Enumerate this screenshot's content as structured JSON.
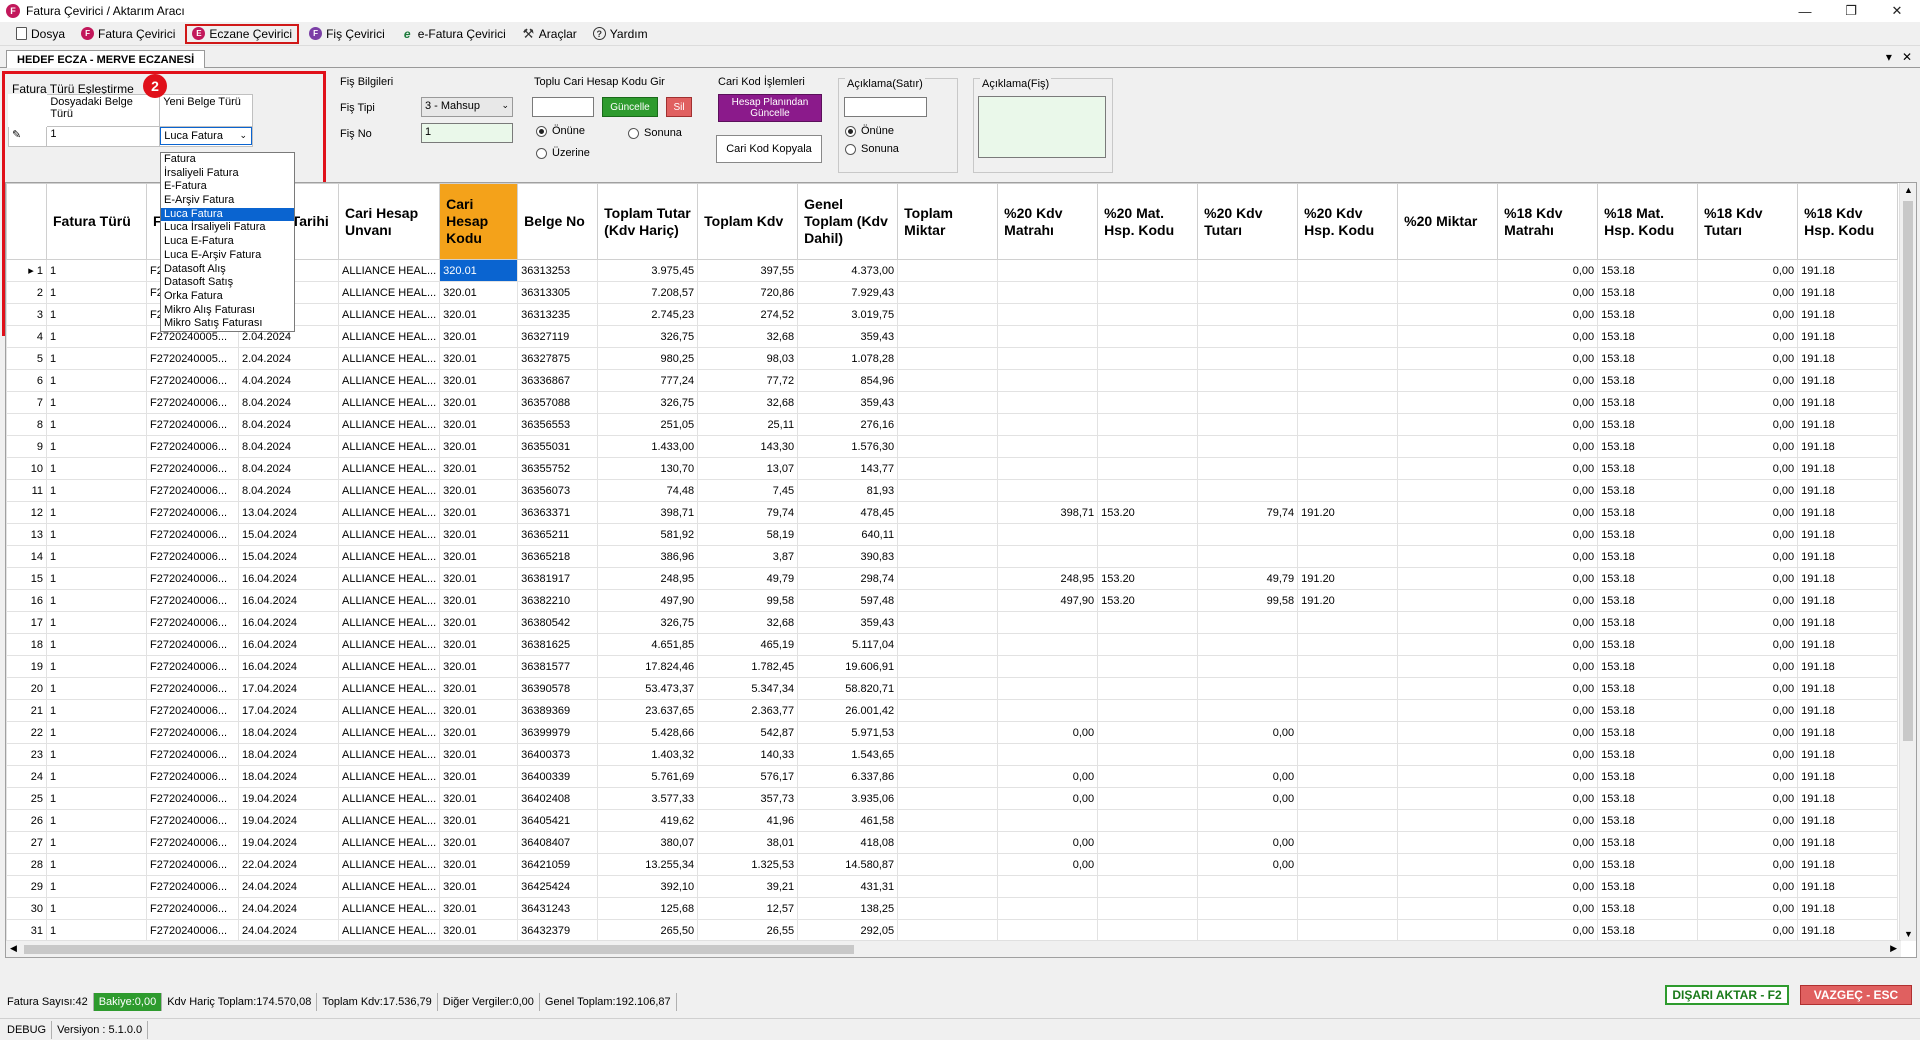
{
  "window": {
    "title": "Fatura Çevirici / Aktarım Aracı",
    "app_icon_letter": "F"
  },
  "menu": [
    {
      "icon": "doc",
      "label": "Dosya"
    },
    {
      "icon": "F",
      "label": "Fatura Çevirici"
    },
    {
      "icon": "E",
      "label": "Eczane Çevirici",
      "selected": true
    },
    {
      "icon": "F",
      "label": "Fiş Çevirici"
    },
    {
      "icon": "e",
      "label": "e-Fatura Çevirici"
    },
    {
      "icon": "tools",
      "label": "Araçlar"
    },
    {
      "icon": "help",
      "label": "Yardım"
    }
  ],
  "tab": {
    "label": "HEDEF ECZA - MERVE ECZANESİ"
  },
  "mapping": {
    "title": "Fatura Türü Eşleştirme",
    "col1": "Dosyadaki Belge Türü",
    "col2": "Yeni Belge Türü",
    "row_value": "1",
    "row_selected": "Luca Fatura",
    "badge": "2",
    "options": [
      "Fatura",
      "İrsaliyeli Fatura",
      "E-Fatura",
      "E-Arşiv Fatura",
      "Luca Fatura",
      "Luca İrsaliyeli Fatura",
      "Luca E-Fatura",
      "Luca E-Arşiv Fatura",
      "Datasoft Alış",
      "Datasoft Satış",
      "Orka Fatura",
      "Mikro Alış Faturası",
      "Mikro Satış Faturası"
    ]
  },
  "fis": {
    "title": "Fiş Bilgileri",
    "tip_label": "Fiş Tipi",
    "tip_value": "3 - Mahsup",
    "no_label": "Fiş No",
    "no_value": "1"
  },
  "toplu": {
    "title": "Toplu Cari Hesap Kodu Gir",
    "update": "Güncelle",
    "delete": "Sil",
    "opt1": "Önüne",
    "opt2": "Sonuna",
    "opt3": "Üzerine"
  },
  "cari": {
    "title": "Cari Kod İşlemleri",
    "btn1": "Hesap Planından Güncelle",
    "btn2": "Cari Kod Kopyala"
  },
  "aciklama_satir": {
    "title": "Açıklama(Satır)",
    "opt1": "Önüne",
    "opt2": "Sonuna"
  },
  "aciklama_fis": {
    "title": "Açıklama(Fiş)"
  },
  "colors": {
    "accent_orange": "#f4a21a",
    "selection_blue": "#0a64d0",
    "red_highlight": "#e0101a",
    "green": "#2e9b2e",
    "purple": "#8b1a8b"
  },
  "grid": {
    "columns": [
      "Fatura Türü",
      "Fatura No",
      "Fatura Tarihi",
      "Cari Hesap Unvanı",
      "Cari Hesap Kodu",
      "Belge No",
      "Toplam Tutar (Kdv Hariç)",
      "Toplam Kdv",
      "Genel Toplam (Kdv Dahil)",
      "Toplam Miktar",
      "%20 Kdv Matrahı",
      "%20 Mat. Hsp. Kodu",
      "%20 Kdv Tutarı",
      "%20 Kdv Hsp. Kodu",
      "%20 Miktar",
      "%18 Kdv Matrahı",
      "%18 Mat. Hsp. Kodu",
      "%18 Kdv Tutarı",
      "%18 Kdv Hsp. Kodu"
    ],
    "rows": [
      [
        "1",
        "1",
        "F2720240005...",
        "",
        "ALLIANCE HEAL...",
        "320.01",
        "36313253",
        "3.975,45",
        "397,55",
        "4.373,00",
        "",
        "",
        "",
        "",
        "",
        "",
        "0,00",
        "153.18",
        "0,00",
        "191.18"
      ],
      [
        "2",
        "1",
        "F2720240005...",
        "",
        "ALLIANCE HEAL...",
        "320.01",
        "36313305",
        "7.208,57",
        "720,86",
        "7.929,43",
        "",
        "",
        "",
        "",
        "",
        "",
        "0,00",
        "153.18",
        "0,00",
        "191.18"
      ],
      [
        "3",
        "1",
        "F2720240005...",
        "",
        "ALLIANCE HEAL...",
        "320.01",
        "36313235",
        "2.745,23",
        "274,52",
        "3.019,75",
        "",
        "",
        "",
        "",
        "",
        "",
        "0,00",
        "153.18",
        "0,00",
        "191.18"
      ],
      [
        "4",
        "1",
        "F2720240005...",
        "2.04.2024",
        "ALLIANCE HEAL...",
        "320.01",
        "36327119",
        "326,75",
        "32,68",
        "359,43",
        "",
        "",
        "",
        "",
        "",
        "",
        "0,00",
        "153.18",
        "0,00",
        "191.18"
      ],
      [
        "5",
        "1",
        "F2720240005...",
        "2.04.2024",
        "ALLIANCE HEAL...",
        "320.01",
        "36327875",
        "980,25",
        "98,03",
        "1.078,28",
        "",
        "",
        "",
        "",
        "",
        "",
        "0,00",
        "153.18",
        "0,00",
        "191.18"
      ],
      [
        "6",
        "1",
        "F2720240006...",
        "4.04.2024",
        "ALLIANCE HEAL...",
        "320.01",
        "36336867",
        "777,24",
        "77,72",
        "854,96",
        "",
        "",
        "",
        "",
        "",
        "",
        "0,00",
        "153.18",
        "0,00",
        "191.18"
      ],
      [
        "7",
        "1",
        "F2720240006...",
        "8.04.2024",
        "ALLIANCE HEAL...",
        "320.01",
        "36357088",
        "326,75",
        "32,68",
        "359,43",
        "",
        "",
        "",
        "",
        "",
        "",
        "0,00",
        "153.18",
        "0,00",
        "191.18"
      ],
      [
        "8",
        "1",
        "F2720240006...",
        "8.04.2024",
        "ALLIANCE HEAL...",
        "320.01",
        "36356553",
        "251,05",
        "25,11",
        "276,16",
        "",
        "",
        "",
        "",
        "",
        "",
        "0,00",
        "153.18",
        "0,00",
        "191.18"
      ],
      [
        "9",
        "1",
        "F2720240006...",
        "8.04.2024",
        "ALLIANCE HEAL...",
        "320.01",
        "36355031",
        "1.433,00",
        "143,30",
        "1.576,30",
        "",
        "",
        "",
        "",
        "",
        "",
        "0,00",
        "153.18",
        "0,00",
        "191.18"
      ],
      [
        "10",
        "1",
        "F2720240006...",
        "8.04.2024",
        "ALLIANCE HEAL...",
        "320.01",
        "36355752",
        "130,70",
        "13,07",
        "143,77",
        "",
        "",
        "",
        "",
        "",
        "",
        "0,00",
        "153.18",
        "0,00",
        "191.18"
      ],
      [
        "11",
        "1",
        "F2720240006...",
        "8.04.2024",
        "ALLIANCE HEAL...",
        "320.01",
        "36356073",
        "74,48",
        "7,45",
        "81,93",
        "",
        "",
        "",
        "",
        "",
        "",
        "0,00",
        "153.18",
        "0,00",
        "191.18"
      ],
      [
        "12",
        "1",
        "F2720240006...",
        "13.04.2024",
        "ALLIANCE HEAL...",
        "320.01",
        "36363371",
        "398,71",
        "79,74",
        "478,45",
        "",
        "398,71",
        "153.20",
        "79,74",
        "191.20",
        "",
        "0,00",
        "153.18",
        "0,00",
        "191.18"
      ],
      [
        "13",
        "1",
        "F2720240006...",
        "15.04.2024",
        "ALLIANCE HEAL...",
        "320.01",
        "36365211",
        "581,92",
        "58,19",
        "640,11",
        "",
        "",
        "",
        "",
        "",
        "",
        "0,00",
        "153.18",
        "0,00",
        "191.18"
      ],
      [
        "14",
        "1",
        "F2720240006...",
        "15.04.2024",
        "ALLIANCE HEAL...",
        "320.01",
        "36365218",
        "386,96",
        "3,87",
        "390,83",
        "",
        "",
        "",
        "",
        "",
        "",
        "0,00",
        "153.18",
        "0,00",
        "191.18"
      ],
      [
        "15",
        "1",
        "F2720240006...",
        "16.04.2024",
        "ALLIANCE HEAL...",
        "320.01",
        "36381917",
        "248,95",
        "49,79",
        "298,74",
        "",
        "248,95",
        "153.20",
        "49,79",
        "191.20",
        "",
        "0,00",
        "153.18",
        "0,00",
        "191.18"
      ],
      [
        "16",
        "1",
        "F2720240006...",
        "16.04.2024",
        "ALLIANCE HEAL...",
        "320.01",
        "36382210",
        "497,90",
        "99,58",
        "597,48",
        "",
        "497,90",
        "153.20",
        "99,58",
        "191.20",
        "",
        "0,00",
        "153.18",
        "0,00",
        "191.18"
      ],
      [
        "17",
        "1",
        "F2720240006...",
        "16.04.2024",
        "ALLIANCE HEAL...",
        "320.01",
        "36380542",
        "326,75",
        "32,68",
        "359,43",
        "",
        "",
        "",
        "",
        "",
        "",
        "0,00",
        "153.18",
        "0,00",
        "191.18"
      ],
      [
        "18",
        "1",
        "F2720240006...",
        "16.04.2024",
        "ALLIANCE HEAL...",
        "320.01",
        "36381625",
        "4.651,85",
        "465,19",
        "5.117,04",
        "",
        "",
        "",
        "",
        "",
        "",
        "0,00",
        "153.18",
        "0,00",
        "191.18"
      ],
      [
        "19",
        "1",
        "F2720240006...",
        "16.04.2024",
        "ALLIANCE HEAL...",
        "320.01",
        "36381577",
        "17.824,46",
        "1.782,45",
        "19.606,91",
        "",
        "",
        "",
        "",
        "",
        "",
        "0,00",
        "153.18",
        "0,00",
        "191.18"
      ],
      [
        "20",
        "1",
        "F2720240006...",
        "17.04.2024",
        "ALLIANCE HEAL...",
        "320.01",
        "36390578",
        "53.473,37",
        "5.347,34",
        "58.820,71",
        "",
        "",
        "",
        "",
        "",
        "",
        "0,00",
        "153.18",
        "0,00",
        "191.18"
      ],
      [
        "21",
        "1",
        "F2720240006...",
        "17.04.2024",
        "ALLIANCE HEAL...",
        "320.01",
        "36389369",
        "23.637,65",
        "2.363,77",
        "26.001,42",
        "",
        "",
        "",
        "",
        "",
        "",
        "0,00",
        "153.18",
        "0,00",
        "191.18"
      ],
      [
        "22",
        "1",
        "F2720240006...",
        "18.04.2024",
        "ALLIANCE HEAL...",
        "320.01",
        "36399979",
        "5.428,66",
        "542,87",
        "5.971,53",
        "",
        "0,00",
        "",
        "0,00",
        "",
        "",
        "0,00",
        "153.18",
        "0,00",
        "191.18"
      ],
      [
        "23",
        "1",
        "F2720240006...",
        "18.04.2024",
        "ALLIANCE HEAL...",
        "320.01",
        "36400373",
        "1.403,32",
        "140,33",
        "1.543,65",
        "",
        "",
        "",
        "",
        "",
        "",
        "0,00",
        "153.18",
        "0,00",
        "191.18"
      ],
      [
        "24",
        "1",
        "F2720240006...",
        "18.04.2024",
        "ALLIANCE HEAL...",
        "320.01",
        "36400339",
        "5.761,69",
        "576,17",
        "6.337,86",
        "",
        "0,00",
        "",
        "0,00",
        "",
        "",
        "0,00",
        "153.18",
        "0,00",
        "191.18"
      ],
      [
        "25",
        "1",
        "F2720240006...",
        "19.04.2024",
        "ALLIANCE HEAL...",
        "320.01",
        "36402408",
        "3.577,33",
        "357,73",
        "3.935,06",
        "",
        "0,00",
        "",
        "0,00",
        "",
        "",
        "0,00",
        "153.18",
        "0,00",
        "191.18"
      ],
      [
        "26",
        "1",
        "F2720240006...",
        "19.04.2024",
        "ALLIANCE HEAL...",
        "320.01",
        "36405421",
        "419,62",
        "41,96",
        "461,58",
        "",
        "",
        "",
        "",
        "",
        "",
        "0,00",
        "153.18",
        "0,00",
        "191.18"
      ],
      [
        "27",
        "1",
        "F2720240006...",
        "19.04.2024",
        "ALLIANCE HEAL...",
        "320.01",
        "36408407",
        "380,07",
        "38,01",
        "418,08",
        "",
        "0,00",
        "",
        "0,00",
        "",
        "",
        "0,00",
        "153.18",
        "0,00",
        "191.18"
      ],
      [
        "28",
        "1",
        "F2720240006...",
        "22.04.2024",
        "ALLIANCE HEAL...",
        "320.01",
        "36421059",
        "13.255,34",
        "1.325,53",
        "14.580,87",
        "",
        "0,00",
        "",
        "0,00",
        "",
        "",
        "0,00",
        "153.18",
        "0,00",
        "191.18"
      ],
      [
        "29",
        "1",
        "F2720240006...",
        "24.04.2024",
        "ALLIANCE HEAL...",
        "320.01",
        "36425424",
        "392,10",
        "39,21",
        "431,31",
        "",
        "",
        "",
        "",
        "",
        "",
        "0,00",
        "153.18",
        "0,00",
        "191.18"
      ],
      [
        "30",
        "1",
        "F2720240006...",
        "24.04.2024",
        "ALLIANCE HEAL...",
        "320.01",
        "36431243",
        "125,68",
        "12,57",
        "138,25",
        "",
        "",
        "",
        "",
        "",
        "",
        "0,00",
        "153.18",
        "0,00",
        "191.18"
      ],
      [
        "31",
        "1",
        "F2720240006...",
        "24.04.2024",
        "ALLIANCE HEAL...",
        "320.01",
        "36432379",
        "265,50",
        "26,55",
        "292,05",
        "",
        "",
        "",
        "",
        "",
        "",
        "0,00",
        "153.18",
        "0,00",
        "191.18"
      ]
    ]
  },
  "status": {
    "count": "Fatura Sayısı:42",
    "balance": "Bakiye:0,00",
    "kdv_haric": "Kdv Hariç Toplam:174.570,08",
    "toplam_kdv": "Toplam Kdv:17.536,79",
    "diger": "Diğer Vergiler:0,00",
    "genel": "Genel Toplam:192.106,87"
  },
  "actions": {
    "export": "DIŞARI AKTAR - F2",
    "cancel": "VAZGEÇ - ESC"
  },
  "footer": {
    "mode": "DEBUG",
    "version": "Versiyon : 5.1.0.0"
  }
}
